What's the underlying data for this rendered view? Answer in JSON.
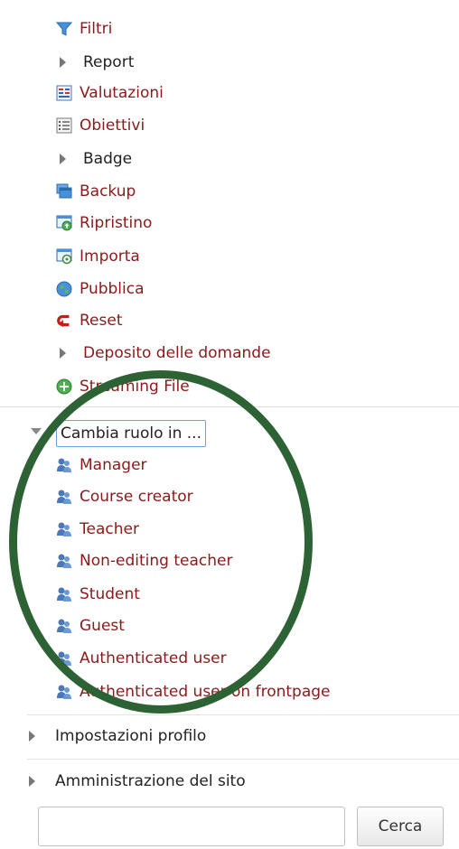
{
  "admin_menu": {
    "items": [
      {
        "label": "Filtri",
        "type": "link",
        "icon": "filter-icon"
      },
      {
        "label": "Report",
        "type": "expandable"
      },
      {
        "label": "Valutazioni",
        "type": "link",
        "icon": "grades-icon"
      },
      {
        "label": "Obiettivi",
        "type": "link",
        "icon": "outcomes-icon"
      },
      {
        "label": "Badge",
        "type": "expandable"
      },
      {
        "label": "Backup",
        "type": "link",
        "icon": "backup-icon"
      },
      {
        "label": "Ripristino",
        "type": "link",
        "icon": "restore-icon"
      },
      {
        "label": "Importa",
        "type": "link",
        "icon": "import-icon"
      },
      {
        "label": "Pubblica",
        "type": "link",
        "icon": "publish-globe-icon"
      },
      {
        "label": "Reset",
        "type": "link",
        "icon": "reset-arrow-icon"
      },
      {
        "label": "Deposito delle domande",
        "type": "expandable-link"
      },
      {
        "label": "Streaming File",
        "type": "link",
        "icon": "add-plus-icon"
      }
    ]
  },
  "switch_role": {
    "label": "Cambia ruolo in ...",
    "roles": [
      "Manager",
      "Course creator",
      "Teacher",
      "Non-editing teacher",
      "Student",
      "Guest",
      "Authenticated user",
      "Authenticated user on frontpage"
    ]
  },
  "sections": {
    "profile_settings": "Impostazioni profilo",
    "site_admin": "Amministrazione del sito"
  },
  "search": {
    "value": "",
    "button_label": "Cerca"
  },
  "colors": {
    "link": "#8b1a1a",
    "highlight_circle": "#2d6235"
  }
}
